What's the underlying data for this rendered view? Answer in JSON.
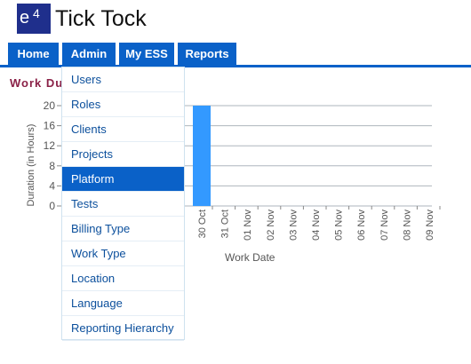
{
  "app": {
    "title": "Tick Tock"
  },
  "nav": {
    "tabs": [
      "Home",
      "Admin",
      "My ESS",
      "Reports"
    ]
  },
  "section": {
    "title": "Work Du"
  },
  "dropdown": {
    "items": [
      "Users",
      "Roles",
      "Clients",
      "Projects",
      "Platform",
      "Tests",
      "Billing Type",
      "Work Type",
      "Location",
      "Language",
      "Reporting Hierarchy"
    ],
    "active": "Platform"
  },
  "chart_data": {
    "type": "bar",
    "categories": [
      "30 Oct",
      "31 Oct",
      "01 Nov",
      "02 Nov",
      "03 Nov",
      "04 Nov",
      "05 Nov",
      "06 Nov",
      "07 Nov",
      "08 Nov",
      "09 Nov"
    ],
    "values": [
      20,
      0,
      0,
      0,
      0,
      0,
      0,
      0,
      0,
      0,
      0
    ],
    "xlabel": "Work Date",
    "ylabel": "Duration (in Hours)",
    "yticks": [
      0,
      4,
      8,
      12,
      16,
      20
    ],
    "ylim": [
      0,
      20
    ],
    "grid": true,
    "colors": {
      "bar": "#3399ff"
    }
  },
  "colors": {
    "nav": "#0a61c8",
    "section_title": "#8a2147",
    "menu_text": "#0b4f9c"
  }
}
